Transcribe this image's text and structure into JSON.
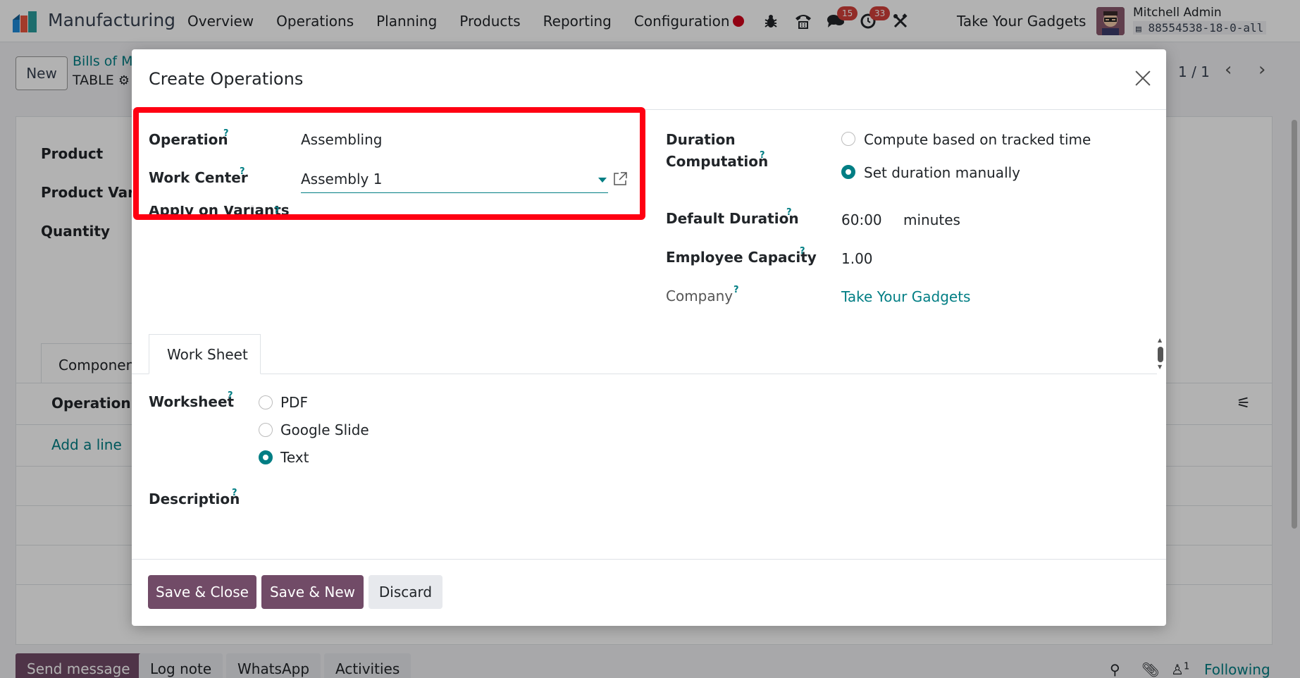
{
  "navbar": {
    "app_name": "Manufacturing",
    "menu": [
      "Overview",
      "Operations",
      "Planning",
      "Products",
      "Reporting",
      "Configuration"
    ],
    "messages_badge": "15",
    "activities_badge": "33",
    "company": "Take Your Gadgets",
    "user_name": "Mitchell Admin",
    "db_name": "88554538-18-0-all"
  },
  "control_panel": {
    "new_label": "New",
    "breadcrumb": "Bills of M",
    "record": "TABLE",
    "pager": "1 / 1"
  },
  "background_form": {
    "product_label": "Product",
    "variant_label": "Product Varia",
    "quantity_label": "Quantity",
    "components_tab": "Componen",
    "operation_header": "Operation",
    "add_line": "Add a line"
  },
  "chatter": {
    "send_message": "Send message",
    "log_note": "Log note",
    "whatsapp": "WhatsApp",
    "activities": "Activities",
    "followers_count": "1",
    "following": "Following"
  },
  "modal": {
    "title": "Create Operations",
    "operation_label": "Operation",
    "operation_value": "Assembling",
    "work_center_label": "Work Center",
    "work_center_value": "Assembly 1",
    "apply_variants_label": "Apply on Variants",
    "duration_label_1": "Duration",
    "duration_label_2": "Computation",
    "duration_options": [
      "Compute based on tracked time",
      "Set duration manually"
    ],
    "duration_selected": "Set duration manually",
    "default_duration_label": "Default Duration",
    "default_duration_value": "60:00",
    "default_duration_unit": "minutes",
    "employee_capacity_label": "Employee Capacity",
    "employee_capacity_value": "1.00",
    "company_label": "Company",
    "company_value": "Take Your Gadgets",
    "tab_label": "Work Sheet",
    "worksheet_label": "Worksheet",
    "worksheet_options": [
      "PDF",
      "Google Slide",
      "Text"
    ],
    "worksheet_selected": "Text",
    "description_label": "Description",
    "help_mark": "?",
    "buttons": {
      "save_close": "Save & Close",
      "save_new": "Save & New",
      "discard": "Discard"
    }
  },
  "colors": {
    "accent": "#017e84",
    "primary": "#714b67",
    "highlight": "#ff0012",
    "badge": "#d23f3a"
  }
}
